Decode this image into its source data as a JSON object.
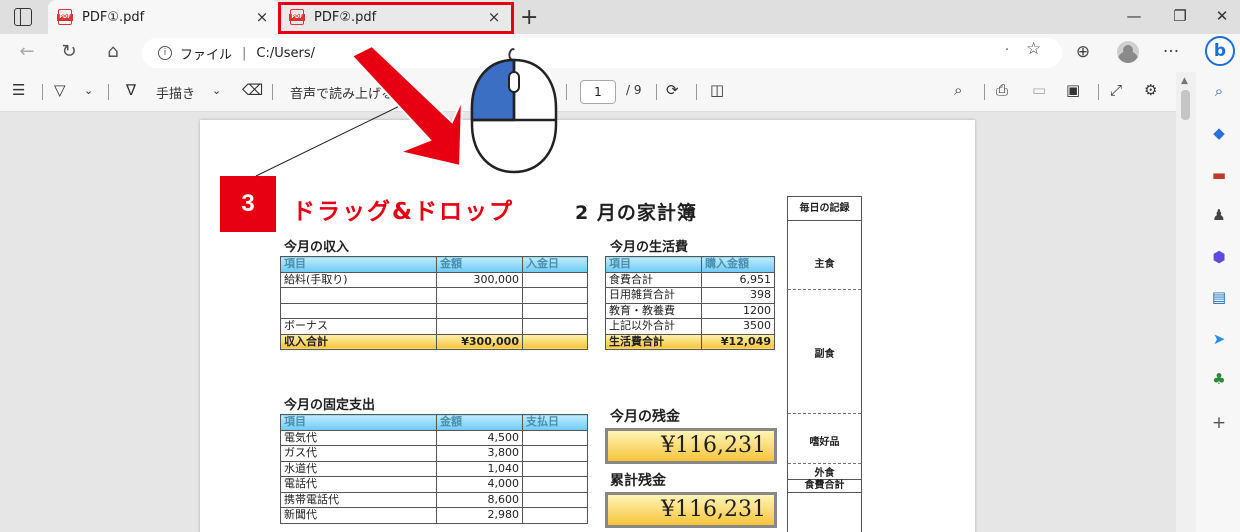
{
  "tabs": [
    {
      "title": "PDF①.pdf",
      "close": "×"
    },
    {
      "title": "PDF②.pdf",
      "close": "×"
    }
  ],
  "new_tab_glyph": "+",
  "window_controls": {
    "minimize": "—",
    "restore": "❐",
    "close": "✕"
  },
  "address": {
    "info_label": "ファイル",
    "url": "C:/Users/",
    "dot": "."
  },
  "toolbar": {
    "draw_label": "手描き",
    "read_aloud_label": "音声で読み上げる",
    "page_current": "1",
    "page_total": "/ 9"
  },
  "overlay": {
    "step_number": "3",
    "step_label": "ドラッグ&ドロップ"
  },
  "document": {
    "title": "2 月の家計簿",
    "income": {
      "title": "今月の収入",
      "headers": [
        "項目",
        "金額",
        "入金日"
      ],
      "rows": [
        [
          "給料(手取り)",
          "300,000",
          ""
        ],
        [
          "",
          "",
          ""
        ],
        [
          "",
          "",
          ""
        ],
        [
          "ボーナス",
          "",
          ""
        ]
      ],
      "total": [
        "収入合計",
        "¥300,000",
        ""
      ]
    },
    "living": {
      "title": "今月の生活費",
      "headers": [
        "項目",
        "購入金額"
      ],
      "rows": [
        [
          "食費合計",
          "6,951"
        ],
        [
          "日用雑貨合計",
          "398"
        ],
        [
          "教育・教養費",
          "1200"
        ],
        [
          "上記以外合計",
          "3500"
        ]
      ],
      "total": [
        "生活費合計",
        "¥12,049"
      ]
    },
    "fixed": {
      "title": "今月の固定支出",
      "headers": [
        "項目",
        "金額",
        "支払日"
      ],
      "rows": [
        [
          "電気代",
          "4,500",
          ""
        ],
        [
          "ガス代",
          "3,800",
          ""
        ],
        [
          "水道代",
          "1,040",
          ""
        ],
        [
          "電話代",
          "4,000",
          ""
        ],
        [
          "携帯電話代",
          "8,600",
          ""
        ],
        [
          "新聞代",
          "2,980",
          ""
        ]
      ]
    },
    "balance": {
      "title": "今月の残金",
      "value": "¥116,231"
    },
    "cumulative": {
      "title": "累計残金",
      "value": "¥116,231"
    },
    "record": {
      "title": "毎日の記録",
      "items": [
        "主食",
        "副食",
        "嗜好品",
        "外食",
        "食費合計"
      ]
    }
  },
  "colors": {
    "accent_red": "#e60012",
    "header_blue": "#6ccbf3",
    "total_yellow": "#f4c43a",
    "mouse_blue": "#3a6fc4"
  }
}
